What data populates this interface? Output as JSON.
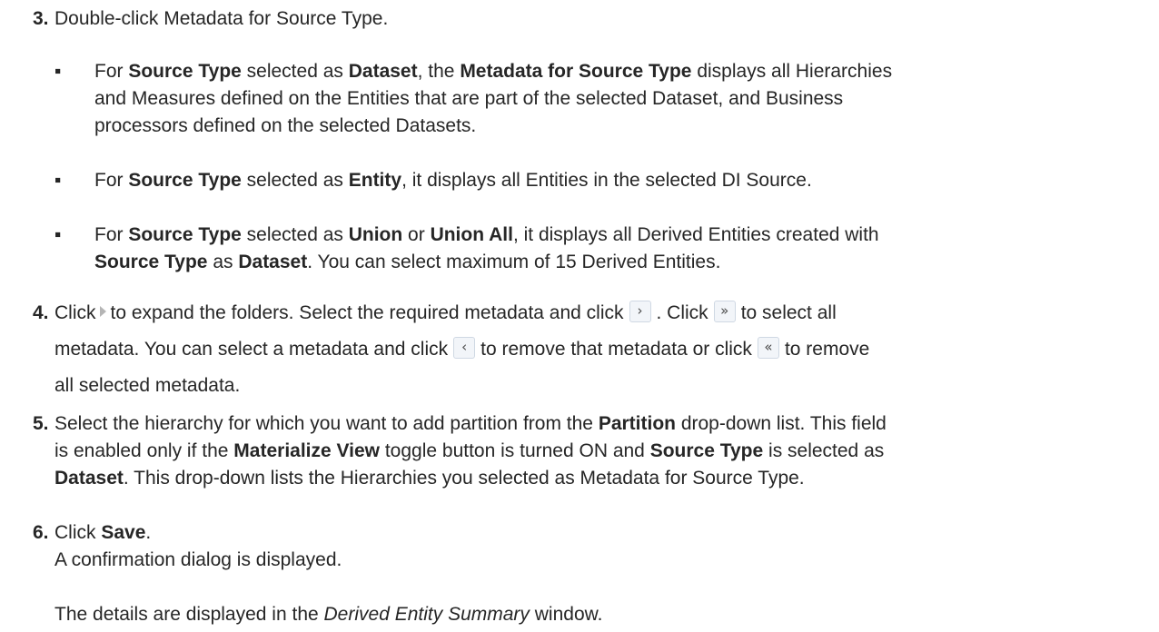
{
  "step3": {
    "number": "3.",
    "text": "Double-click Metadata for Source Type.",
    "bullets": [
      {
        "b1": "For ",
        "bold1": "Source Type",
        "t2": " selected as ",
        "bold2": "Dataset",
        "t3": ", the ",
        "bold3": "Metadata for Source Type",
        "t4": " displays all Hierarchies",
        "line2": "and Measures defined on the Entities that are part of the selected Dataset, and Business",
        "line3": "processors defined on the selected Datasets."
      },
      {
        "b1": "For ",
        "bold1": "Source Type",
        "t2": " selected as ",
        "bold2": "Entity",
        "t3": ", it displays all Entities in the selected DI Source."
      },
      {
        "b1": "For ",
        "bold1": "Source Type",
        "t2": " selected as ",
        "bold2": "Union",
        "t3": " or ",
        "bold3": "Union All",
        "t4": ", it displays all Derived Entities created with",
        "bold4": "Source Type",
        "t5": " as ",
        "bold5": "Dataset",
        "t6": ".  You can select maximum of 15 Derived Entities."
      }
    ]
  },
  "step4": {
    "number": "4.",
    "a": "Click",
    "b": "to expand the folders. Select the required metadata and click",
    "c": ". Click",
    "d": "to select all",
    "e": "metadata. You can select a metadata and click",
    "f": "to remove that metadata or click",
    "g": "to remove",
    "h": "all selected metadata.",
    "icons": {
      "expand": "›",
      "select": "›",
      "select_all": "»",
      "remove": "‹",
      "remove_all": "«"
    }
  },
  "step5": {
    "number": "5.",
    "a": "Select the hierarchy for which you want to add partition from the ",
    "bold1": "Partition",
    "b": " drop-down list. This field",
    "c": "is enabled only if the ",
    "bold2": "Materialize View",
    "d": " toggle button is turned ON and ",
    "bold3": "Source Type",
    "e": " is selected as",
    "bold4": "Dataset",
    "f": ". This drop-down lists the Hierarchies you selected as Metadata for Source Type."
  },
  "step6": {
    "number": "6.",
    "a": "Click ",
    "bold1": "Save",
    "b": ".",
    "line2": "A confirmation dialog is displayed.",
    "line3a": "The details are displayed in the ",
    "italic": "Derived Entity Summary",
    "line3b": " window."
  },
  "bullet_char": "▪"
}
